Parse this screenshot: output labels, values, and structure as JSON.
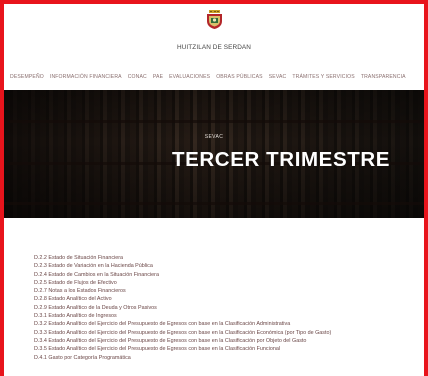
{
  "site": {
    "name": "HUITZILAN DE SERDAN"
  },
  "nav": [
    "DESEMPEÑO",
    "INFORMACIÓN FINANCIERA",
    "CONAC",
    "PAE",
    "EVALUACIONES",
    "OBRAS PÚBLICAS",
    "SEVAC",
    "TRÁMITES Y SERVICIOS",
    "TRANSPARENCIA"
  ],
  "hero": {
    "kicker": "SEVAC",
    "title": "TERCER TRIMESTRE"
  },
  "links": [
    "D.2.2 Estado de Situación Financiera",
    "D.2.3 Estado de Variación en la Hacienda Pública",
    "D.2.4 Estado de Cambios en la Situación Financiera",
    "D.2.5 Estado de Flujos de Efectivo",
    "D.2.7 Notas a los Estados Financieros",
    "D.2.8 Estado Analítico del Activo",
    "D.2.9 Estado Analítico de la Deuda y Otros Pasivos",
    "D.3.1 Estado Analítico de Ingresos",
    "D.3.2 Estado Analítico del Ejercicio del Presupuesto de Egresos con base en la Clasificación Administrativa",
    "D.3.3 Estado Analítico del Ejercicio del Presupuesto de Egresos con base en la Clasificación Económica (por Tipo de Gasto)",
    "D.3.4 Estado Analítico del Ejercicio del Presupuesto de Egresos con base en la Clasificación por Objeto del Gasto",
    "D.3.5 Estado Analítico del Ejercicio del Presupuesto de Egresos con base en la Clasificación Funcional",
    "D.4.1 Gasto por Categoría Programática"
  ],
  "colors": {
    "frame": "#e8141c",
    "link": "#6a4646",
    "hero_title": "#ffffff"
  }
}
